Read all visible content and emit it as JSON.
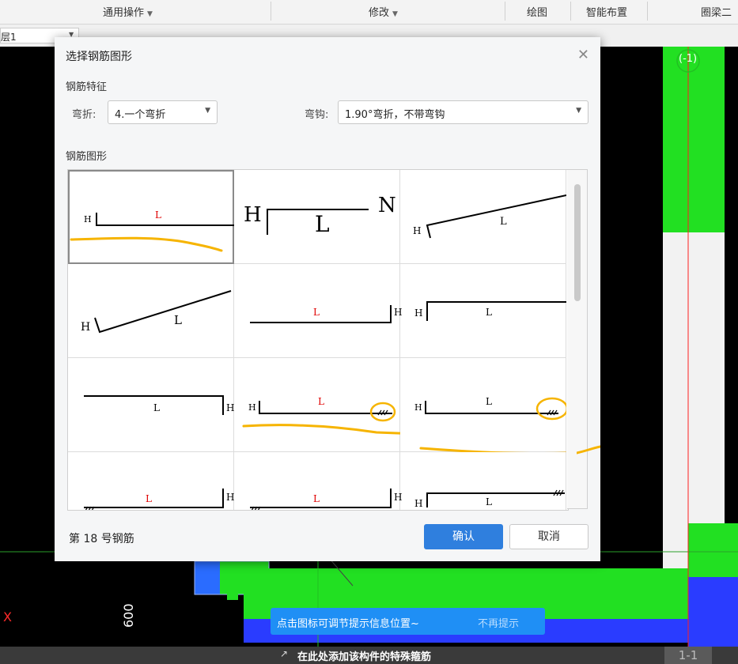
{
  "toolbar": {
    "general_ops": "通用操作",
    "modify": "修改",
    "draw": "绘图",
    "smart_layout": "智能布置",
    "ring_beam": "圈梁二"
  },
  "layer": {
    "value": "层1"
  },
  "dialog": {
    "title": "选择钢筋图形",
    "section_features": "钢筋特征",
    "bend_label": "弯折:",
    "bend_value": "4.一个弯折",
    "hook_label": "弯钩:",
    "hook_value": "1.90°弯折，不带弯钩",
    "section_shapes": "钢筋图形",
    "footer_status": "第 18 号钢筋",
    "ok_label": "确认",
    "cancel_label": "取消",
    "shape_letters": {
      "h": "H",
      "l": "L",
      "n": "N"
    }
  },
  "canvas": {
    "axis_label": "(-1)",
    "x_label": "X",
    "dimension": "600"
  },
  "tip": {
    "text": "点击图标可调节提示信息位置~",
    "dismiss": "不再提示"
  },
  "status": {
    "message": "在此处添加该构件的特殊箍筋",
    "coord_label": "1-1"
  },
  "colors": {
    "accent": "#2f7fde",
    "green": "#22e022",
    "blue": "#2a3cff",
    "highlight": "#f6b400",
    "red_text": "#e00000"
  }
}
